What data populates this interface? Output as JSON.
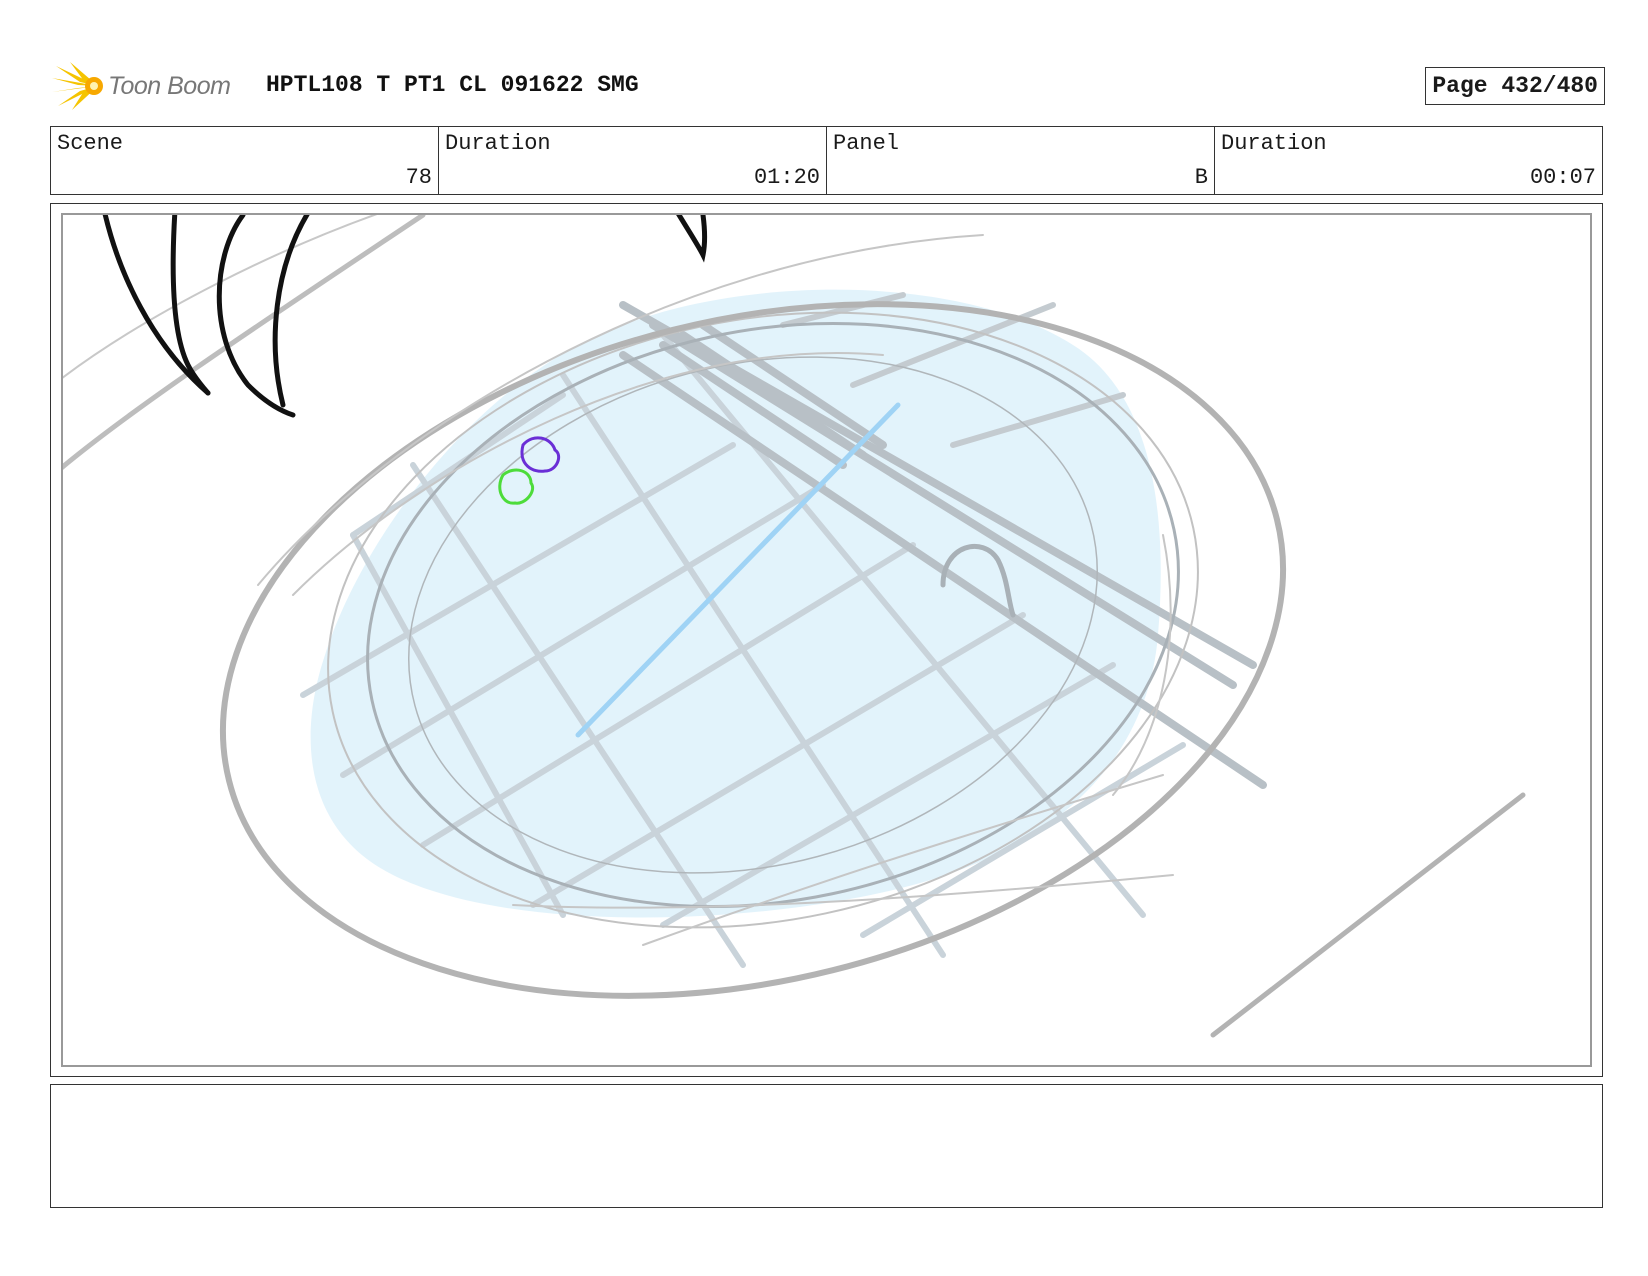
{
  "header": {
    "logo_text": "Toon Boom",
    "logo_icon": "starburst-icon",
    "document_title": "HPTL108 T PT1 CL 091622 SMG",
    "page_label": "Page 432/480"
  },
  "info": {
    "scene_label": "Scene",
    "scene_value": "78",
    "scene_duration_label": "Duration",
    "scene_duration_value": "01:20",
    "panel_label": "Panel",
    "panel_value": "B",
    "panel_duration_label": "Duration",
    "panel_duration_value": "00:07"
  },
  "notes": {
    "text": ""
  },
  "colors": {
    "pool_fill": "#dff2fb",
    "sketch_gray": "#b3b3b3",
    "ink_black": "#111111",
    "marker_purple": "#6a2fd6",
    "marker_green": "#4ddc3a",
    "highlight_blue": "#9fd3f5",
    "logo_yellow": "#f5c400"
  }
}
